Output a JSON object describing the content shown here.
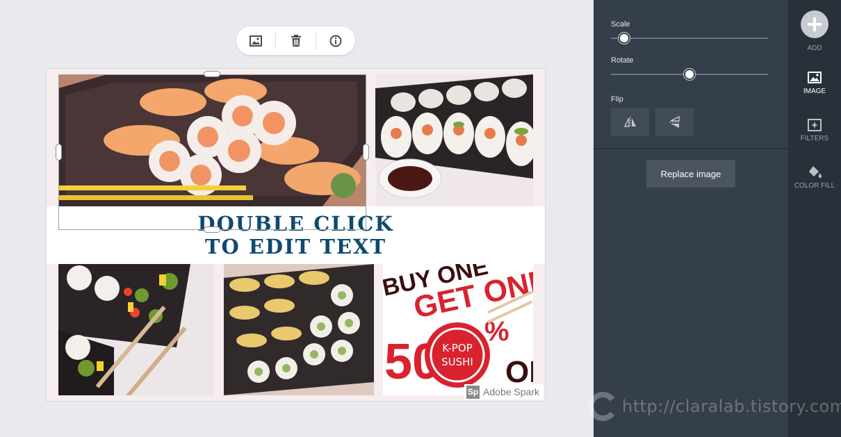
{
  "toolbar": {
    "buttons": [
      "replace-image",
      "delete",
      "info"
    ]
  },
  "canvas": {
    "banner_line1": "DOUBLE CLICK",
    "banner_line2": "TO EDIT TEXT",
    "promo_buy": "BUY ONE",
    "promo_get": "GET ONE",
    "promo_50": "50",
    "promo_percent": "%",
    "promo_off": "OF",
    "promo_seal1": "K-POP",
    "promo_seal2": "SUSHI",
    "branding_logo": "Sp",
    "branding_text": "Adobe Spark"
  },
  "panel": {
    "scale_label": "Scale",
    "scale_value": 0.05,
    "rotate_label": "Rotate",
    "rotate_value": 0.5,
    "flip_label": "Flip",
    "replace_label": "Replace image"
  },
  "rail": {
    "add": "ADD",
    "image": "IMAGE",
    "filters": "FILTERS",
    "color_fill": "COLOR FILL"
  },
  "watermark": {
    "url": "http://claralab.tistory.com"
  },
  "colors": {
    "banner_text": "#0e4a6f",
    "panel_bg": "#343f4b",
    "rail_bg": "#28313a",
    "promo_red": "#d8232f"
  }
}
